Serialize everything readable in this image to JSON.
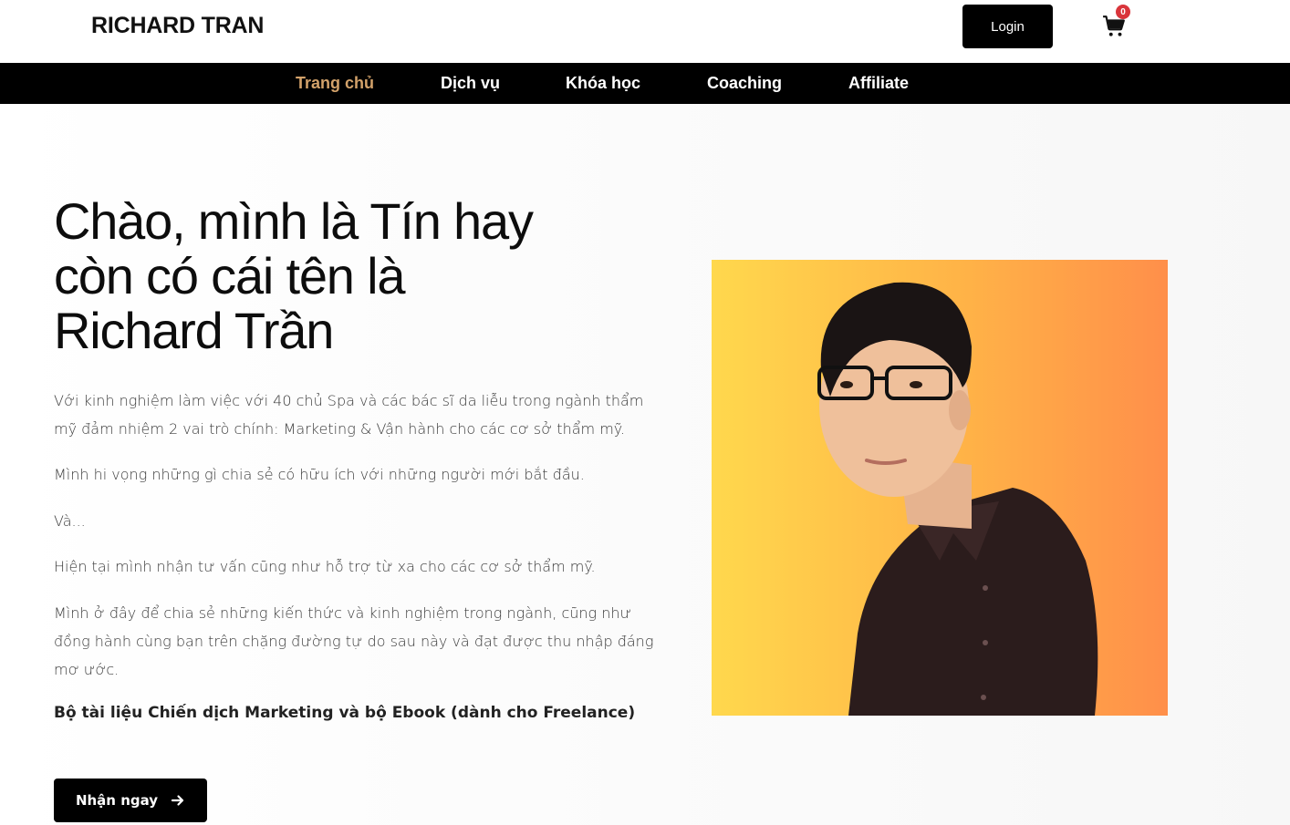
{
  "header": {
    "brand": "RICHARD TRAN",
    "login_label": "Login",
    "cart_count": "0",
    "cart_icon": "cart-icon"
  },
  "nav": {
    "items": [
      {
        "label": "Trang chủ",
        "active": true
      },
      {
        "label": "Dịch vụ",
        "active": false
      },
      {
        "label": "Khóa học",
        "active": false
      },
      {
        "label": "Coaching",
        "active": false
      },
      {
        "label": "Affiliate",
        "active": false
      }
    ]
  },
  "hero": {
    "headline_line1": "Chào, mình là Tín hay",
    "headline_line2": "còn có cái tên là",
    "headline_line3": "Richard Trần",
    "paragraphs": [
      "Với kinh nghiệm làm việc với 40 chủ Spa và các bác sĩ da liễu trong ngành thẩm mỹ đảm nhiệm 2 vai trò chính: Marketing & Vận hành cho các cơ sở thẩm mỹ.",
      "Mình hi vọng những gì chia sẻ có hữu ích với những người mới bắt đầu.",
      "Và...",
      "Hiện tại mình nhận tư vấn cũng như hỗ trợ từ xa cho các cơ sở thẩm mỹ.",
      "Mình ở đây để chia sẻ những kiến thức và kinh nghiệm trong ngành, cũng như đồng hành cùng bạn trên chặng đường tự do sau này và đạt được thu nhập đáng mơ ước."
    ],
    "highlight": "Bộ tài liệu Chiến dịch Marketing và bộ Ebook (dành cho Freelance)",
    "cta_label": "Nhận ngay",
    "cta_icon": "arrow-right-icon"
  },
  "colors": {
    "accent_nav_active": "#d3a26a",
    "nav_bg": "#000000",
    "badge": "#d9353b",
    "portrait_bg_left": "#ffd84d",
    "portrait_bg_right": "#ff8f4a"
  }
}
